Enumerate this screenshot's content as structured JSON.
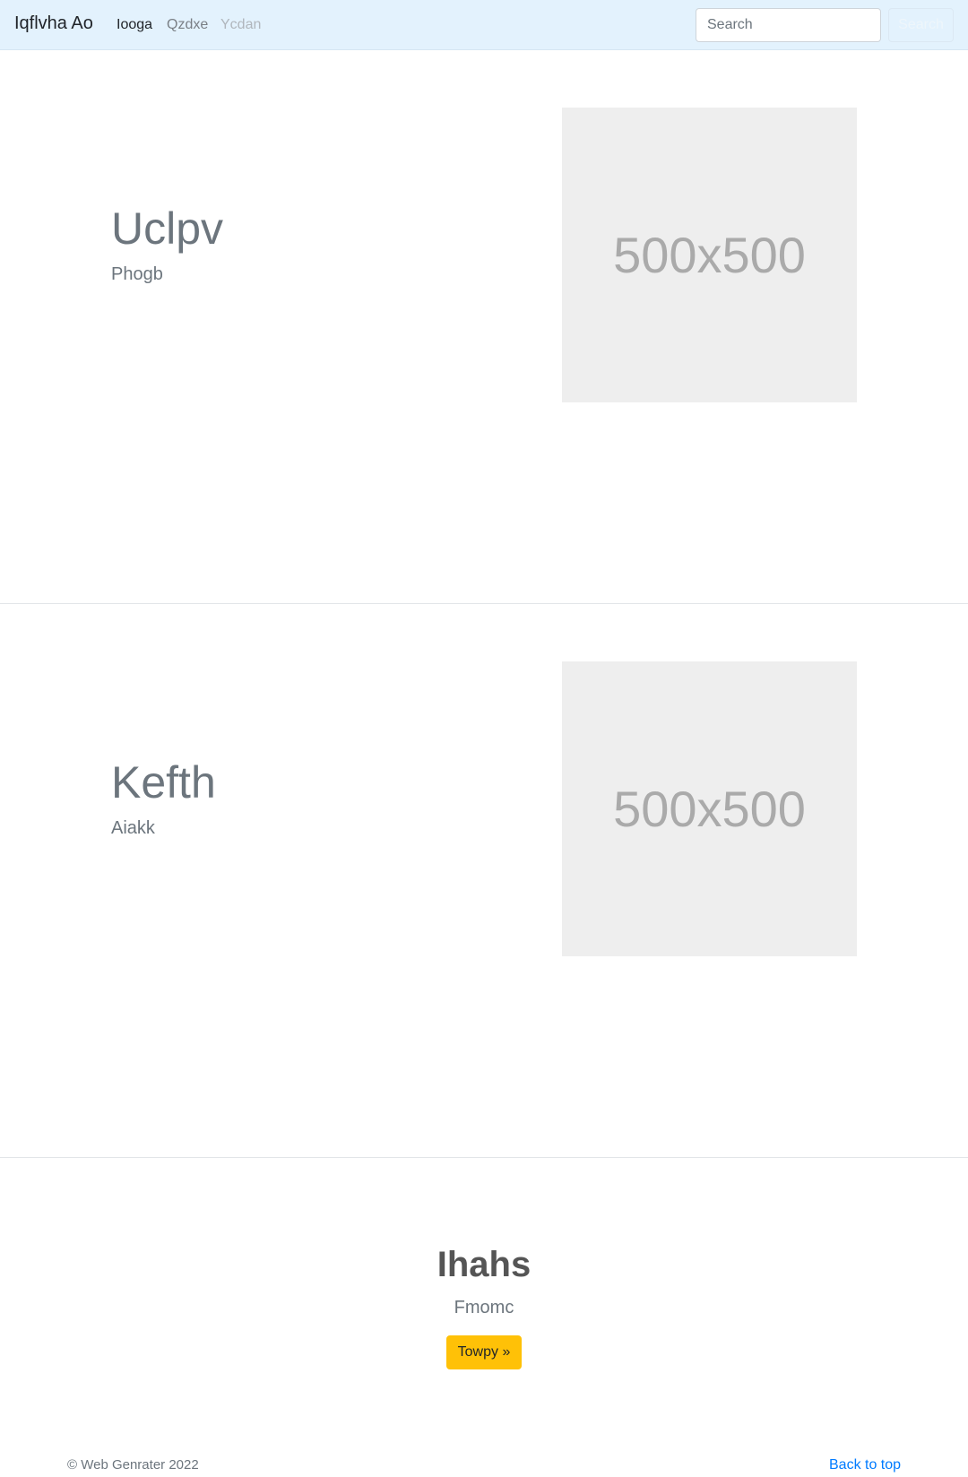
{
  "navbar": {
    "brand": "Iqflvha Ao",
    "links": [
      "Iooga",
      "Qzdxe",
      "Ycdan"
    ],
    "search_placeholder": "Search",
    "search_button": "Search"
  },
  "features": [
    {
      "heading": "Uclpv",
      "subheading": "Phogb",
      "image_text": "500x500"
    },
    {
      "heading": "Kefth",
      "subheading": "Aiakk",
      "image_text": "500x500"
    }
  ],
  "cta": {
    "title": "Ihahs",
    "subtitle": "Fmomc",
    "button": "Towpy »"
  },
  "footer": {
    "copyright": "© Web Genrater 2022",
    "back_to_top": "Back to top"
  },
  "colors": {
    "navbar_bg": "#e3f2fd",
    "cta_button": "#ffc107",
    "link": "#007bff",
    "placeholder_bg": "#eeeeee"
  }
}
